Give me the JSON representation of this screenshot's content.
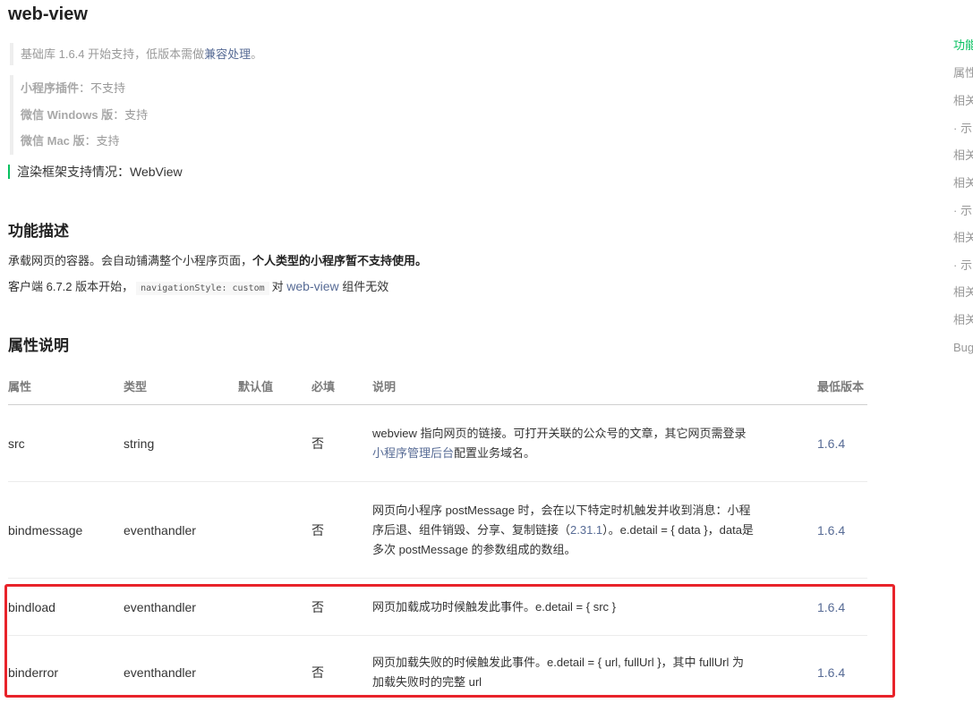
{
  "page": {
    "title": "web-view",
    "notice_basic_prefix": "基础库 1.6.4 开始支持，低版本需做",
    "notice_basic_link": "兼容处理",
    "notice_basic_suffix": "。",
    "platforms": [
      {
        "label": "小程序插件",
        "sep": "：",
        "value": "不支持"
      },
      {
        "label": "微信 Windows 版",
        "sep": "：",
        "value": "支持"
      },
      {
        "label": "微信 Mac 版",
        "sep": "：",
        "value": "支持"
      }
    ],
    "render_note": "渲染框架支持情况：WebView"
  },
  "function_section": {
    "heading": "功能描述",
    "p1_text": "承载网页的容器。会自动铺满整个小程序页面，",
    "p1_bold": "个人类型的小程序暂不支持使用。",
    "p2_prefix": "客户端 6.7.2 版本开始，",
    "p2_code": "navigationStyle: custom",
    "p2_mid": "对",
    "p2_link": "web-view",
    "p2_suffix": "组件无效"
  },
  "attr_section": {
    "heading": "属性说明",
    "headers": [
      "属性",
      "类型",
      "默认值",
      "必填",
      "说明",
      "最低版本"
    ],
    "rows": [
      {
        "name": "src",
        "type": "string",
        "default": "",
        "required": "否",
        "desc": "webview 指向网页的链接。可打开关联的公众号的文章，其它网页需登录",
        "desc_link": "小程序管理后台",
        "desc_suffix": "配置业务域名。",
        "version": "1.6.4"
      },
      {
        "name": "bindmessage",
        "type": "eventhandler",
        "default": "",
        "required": "否",
        "desc": "网页向小程序 postMessage 时，会在以下特定时机触发并收到消息：小程序后退、组件销毁、分享、复制链接（",
        "desc_link": "2.31.1",
        "desc_suffix": "）。e.detail = { data }，data是多次 postMessage 的参数组成的数组。",
        "version": "1.6.4"
      },
      {
        "name": "bindload",
        "type": "eventhandler",
        "default": "",
        "required": "否",
        "desc": "网页加载成功时候触发此事件。e.detail = { src }",
        "desc_link": "",
        "desc_suffix": "",
        "version": "1.6.4"
      },
      {
        "name": "binderror",
        "type": "eventhandler",
        "default": "",
        "required": "否",
        "desc": "网页加载失败的时候触发此事件。e.detail = { url, fullUrl }，其中 fullUrl 为加载失败时的完整 url",
        "desc_link": "",
        "desc_suffix": "",
        "version": "1.6.4"
      }
    ]
  },
  "toc": {
    "items": [
      "功能",
      "属性",
      "相关",
      "· 示",
      "相关",
      "相关",
      "· 示",
      "相关",
      "· 示",
      "相关",
      "相关",
      "Bug"
    ]
  },
  "colors": {
    "accent_green": "#07c160",
    "link_blue": "#576b95",
    "highlight_red": "#e8232a"
  }
}
